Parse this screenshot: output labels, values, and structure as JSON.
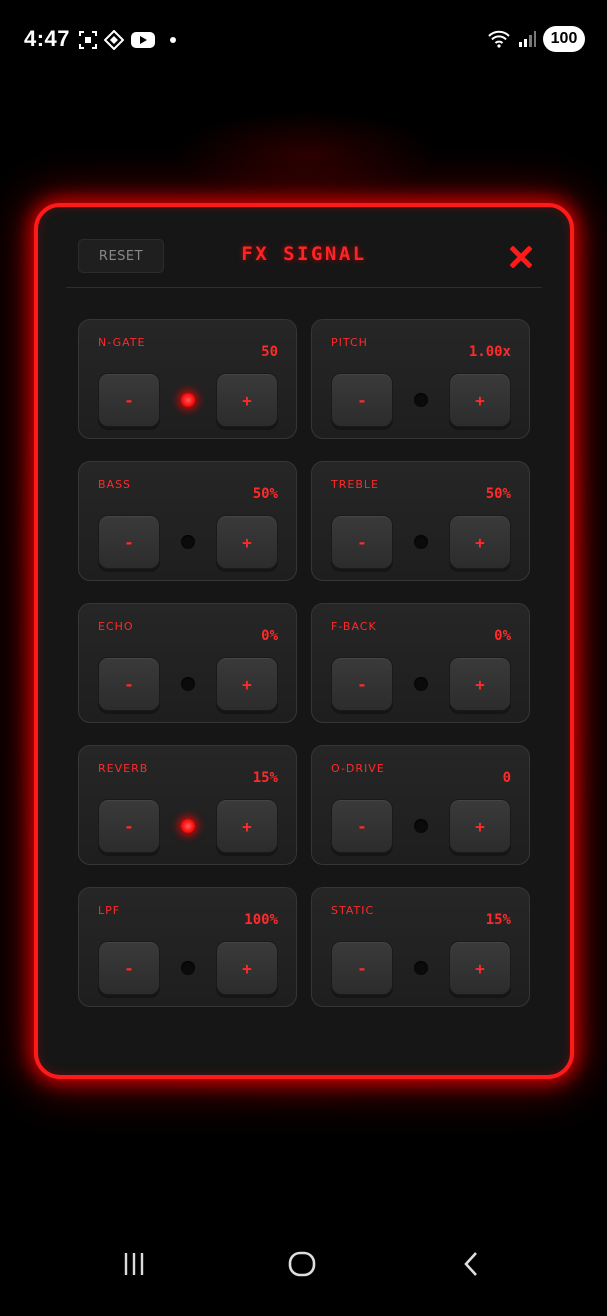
{
  "status_bar": {
    "time": "4:47",
    "left_icons": [
      "screenshot-icon",
      "vpn-icon",
      "youtube-icon",
      "notification-dot"
    ],
    "right_icons": [
      "wifi-icon",
      "signal-icon"
    ],
    "battery": "100"
  },
  "panel": {
    "title": "FX SIGNAL",
    "reset_label": "RESET",
    "close_icon": "close-x-icon",
    "accent_color": "#ff1a1a"
  },
  "controls": [
    {
      "id": "n-gate",
      "label": "N-GATE",
      "value": "50",
      "led_on": true,
      "minus": "-",
      "plus": "+"
    },
    {
      "id": "pitch",
      "label": "PITCH",
      "value": "1.00x",
      "led_on": false,
      "minus": "-",
      "plus": "+"
    },
    {
      "id": "bass",
      "label": "BASS",
      "value": "50%",
      "led_on": false,
      "minus": "-",
      "plus": "+"
    },
    {
      "id": "treble",
      "label": "TREBLE",
      "value": "50%",
      "led_on": false,
      "minus": "-",
      "plus": "+"
    },
    {
      "id": "echo",
      "label": "ECHO",
      "value": "0%",
      "led_on": false,
      "minus": "-",
      "plus": "+"
    },
    {
      "id": "f-back",
      "label": "F-BACK",
      "value": "0%",
      "led_on": false,
      "minus": "-",
      "plus": "+"
    },
    {
      "id": "reverb",
      "label": "REVERB",
      "value": "15%",
      "led_on": true,
      "minus": "-",
      "plus": "+"
    },
    {
      "id": "o-drive",
      "label": "O-DRIVE",
      "value": "0",
      "led_on": false,
      "minus": "-",
      "plus": "+"
    },
    {
      "id": "lpf",
      "label": "LPF",
      "value": "100%",
      "led_on": false,
      "minus": "-",
      "plus": "+"
    },
    {
      "id": "static",
      "label": "STATIC",
      "value": "15%",
      "led_on": false,
      "minus": "-",
      "plus": "+"
    }
  ],
  "nav_bar": {
    "buttons": [
      "recents-icon",
      "home-icon",
      "back-icon"
    ]
  }
}
